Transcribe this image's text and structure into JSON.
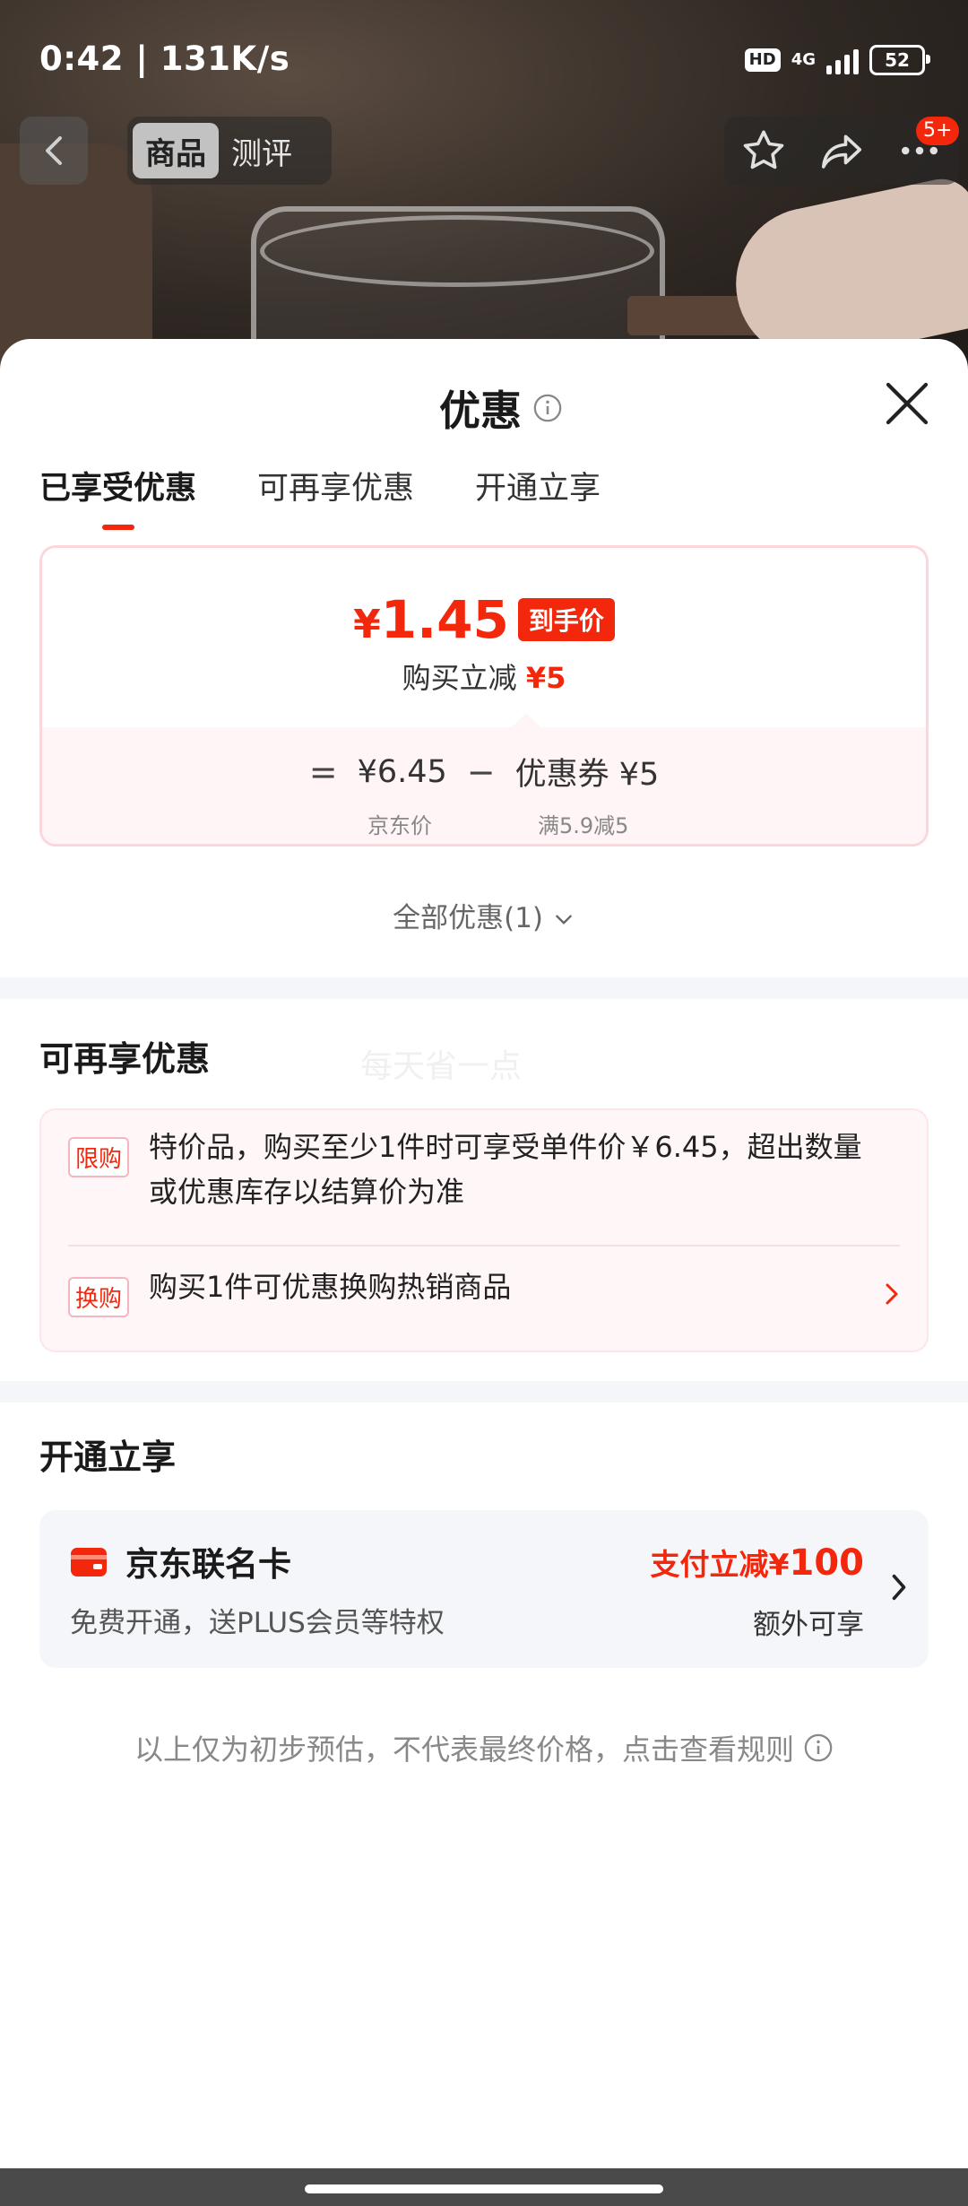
{
  "status_bar": {
    "time_speed": "0:42 | 131K/s",
    "hd": "HD",
    "network": "4G",
    "battery": "52"
  },
  "top_nav": {
    "tabs": [
      {
        "label": "商品",
        "active": true
      },
      {
        "label": "测评",
        "active": false
      }
    ],
    "message_badge": "5+"
  },
  "sheet": {
    "title": "优惠",
    "tabs": [
      {
        "label": "已享受优惠",
        "active": true
      },
      {
        "label": "可再享优惠",
        "active": false
      },
      {
        "label": "开通立享",
        "active": false
      }
    ],
    "price_card": {
      "currency": "¥",
      "final_price": "1.45",
      "final_badge": "到手价",
      "direct_cut_label": "购买立减",
      "direct_cut_value": "¥5",
      "equals": "=",
      "jd_price": "¥6.45",
      "minus": "−",
      "coupon": "优惠券 ¥5",
      "jd_price_label": "京东价",
      "coupon_condition": "满5.9减5"
    },
    "all_offers_label": "全部优惠(1)",
    "extra_section": {
      "title": "可再享优惠",
      "watermark": "每天省一点",
      "offers": [
        {
          "tag": "限购",
          "line1": "特价品，购买至少1件时可享受单件价￥6.45，超出数量",
          "line2": "或优惠库存以结算价为准"
        },
        {
          "tag": "换购",
          "line1": "购买1件可优惠换购热销商品"
        }
      ]
    },
    "open_section": {
      "title": "开通立享",
      "card_name": "京东联名卡",
      "card_desc": "免费开通，送PLUS会员等特权",
      "promo_prefix": "支付立减¥",
      "promo_amount": "100",
      "extra": "额外可享"
    },
    "disclaimer": "以上仅为初步预估，不代表最终价格，点击查看规则"
  },
  "colors": {
    "accent": "#f2270c",
    "card_border": "#fbd7dc",
    "section_bg": "#f5f6fa"
  },
  "icons": [
    "back-arrow-icon",
    "star-icon",
    "share-icon",
    "more-icon",
    "info-icon",
    "close-icon",
    "chevron-down-icon",
    "chevron-right-icon",
    "credit-card-icon"
  ]
}
